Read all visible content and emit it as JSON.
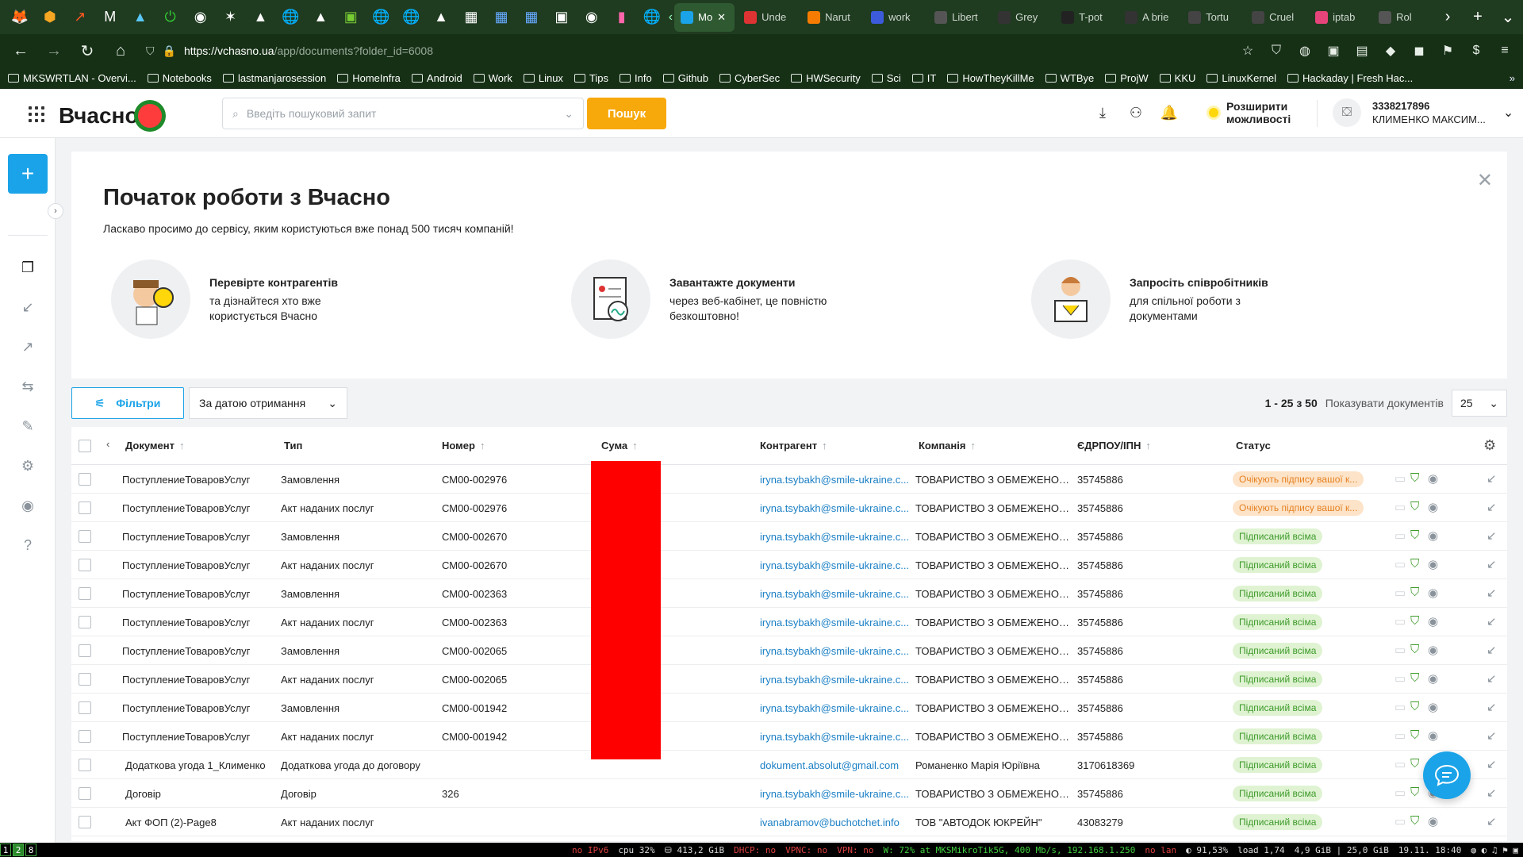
{
  "browser": {
    "tabs": [
      {
        "label": "Mo",
        "color": "#1aa3e8",
        "active": true
      },
      {
        "label": "Unde",
        "color": "#d33"
      },
      {
        "label": "Narut",
        "color": "#f57c00"
      },
      {
        "label": "work",
        "color": "#3b5bdb"
      },
      {
        "label": "Libert",
        "color": "#555"
      },
      {
        "label": "Grey",
        "color": "#333"
      },
      {
        "label": "T-pot",
        "color": "#222"
      },
      {
        "label": "A brie",
        "color": "#333"
      },
      {
        "label": "Tortu",
        "color": "#444"
      },
      {
        "label": "Cruel",
        "color": "#444"
      },
      {
        "label": "iptab",
        "color": "#e5447a"
      },
      {
        "label": "Rol",
        "color": "#555"
      }
    ],
    "url_host": "https://vchasno.ua",
    "url_path": "/app/documents?folder_id=6008",
    "bookmarks": [
      "MKSWRTLAN - Overvi...",
      "Notebooks",
      "lastmanjarosession",
      "HomeInfra",
      "Android",
      "Work",
      "Linux",
      "Tips",
      "Info",
      "Github",
      "CyberSec",
      "HWSecurity",
      "Sci",
      "IT",
      "HowTheyKillMe",
      "WTBye",
      "ProjW",
      "KKU",
      "LinuxKernel",
      "Hackaday | Fresh Hac..."
    ]
  },
  "header": {
    "logo": "Вчасно",
    "search_placeholder": "Введіть пошуковий запит",
    "search_button": "Пошук",
    "expand_label": "Розширити можливості",
    "account_id": "3338217896",
    "account_name": "КЛИМЕНКО МАКСИМ..."
  },
  "welcome": {
    "title": "Початок роботи з Вчасно",
    "subtitle": "Ласкаво просимо до сервісу, яким користуються вже понад 500 тисяч компаній!",
    "steps": [
      {
        "title": "Перевірте контрагентів",
        "text": "та дізнайтеся хто вже користується Вчасно"
      },
      {
        "title": "Завантажте документи",
        "text": "через веб-кабінет, це повністю безкоштовно!"
      },
      {
        "title": "Запросіть співробітників",
        "text": "для спільної роботи з документами"
      }
    ]
  },
  "toolbar": {
    "filters_label": "Фільтри",
    "sort_label": "За датою отримання",
    "range": "1 - 25 з 50",
    "show_label": "Показувати документів",
    "page_size": "25"
  },
  "table": {
    "columns": [
      "Документ",
      "Тип",
      "Номер",
      "Сума",
      "Контрагент",
      "Компанія",
      "ЄДРПОУ/ІПН",
      "Статус"
    ],
    "rows": [
      {
        "doc": "ПоступлениеТоваровУслуг",
        "type": "Замовлення",
        "num": "СМ00-002976",
        "contr": "iryna.tsybakh@smile-ukraine.c...",
        "comp": "ТОВАРИСТВО З ОБМЕЖЕНОЮ...",
        "code": "35745886",
        "status": "Очікують підпису вашої к...",
        "st": "wait"
      },
      {
        "doc": "ПоступлениеТоваровУслуг",
        "type": "Акт наданих послуг",
        "num": "СМ00-002976",
        "contr": "iryna.tsybakh@smile-ukraine.c...",
        "comp": "ТОВАРИСТВО З ОБМЕЖЕНОЮ...",
        "code": "35745886",
        "status": "Очікують підпису вашої к...",
        "st": "wait"
      },
      {
        "doc": "ПоступлениеТоваровУслуг",
        "type": "Замовлення",
        "num": "СМ00-002670",
        "contr": "iryna.tsybakh@smile-ukraine.c...",
        "comp": "ТОВАРИСТВО З ОБМЕЖЕНОЮ...",
        "code": "35745886",
        "status": "Підписаний всіма",
        "st": "ok"
      },
      {
        "doc": "ПоступлениеТоваровУслуг",
        "type": "Акт наданих послуг",
        "num": "СМ00-002670",
        "contr": "iryna.tsybakh@smile-ukraine.c...",
        "comp": "ТОВАРИСТВО З ОБМЕЖЕНОЮ...",
        "code": "35745886",
        "status": "Підписаний всіма",
        "st": "ok"
      },
      {
        "doc": "ПоступлениеТоваровУслуг",
        "type": "Замовлення",
        "num": "СМ00-002363",
        "contr": "iryna.tsybakh@smile-ukraine.c...",
        "comp": "ТОВАРИСТВО З ОБМЕЖЕНОЮ...",
        "code": "35745886",
        "status": "Підписаний всіма",
        "st": "ok"
      },
      {
        "doc": "ПоступлениеТоваровУслуг",
        "type": "Акт наданих послуг",
        "num": "СМ00-002363",
        "contr": "iryna.tsybakh@smile-ukraine.c...",
        "comp": "ТОВАРИСТВО З ОБМЕЖЕНОЮ...",
        "code": "35745886",
        "status": "Підписаний всіма",
        "st": "ok"
      },
      {
        "doc": "ПоступлениеТоваровУслуг",
        "type": "Замовлення",
        "num": "СМ00-002065",
        "contr": "iryna.tsybakh@smile-ukraine.c...",
        "comp": "ТОВАРИСТВО З ОБМЕЖЕНОЮ...",
        "code": "35745886",
        "status": "Підписаний всіма",
        "st": "ok"
      },
      {
        "doc": "ПоступлениеТоваровУслуг",
        "type": "Акт наданих послуг",
        "num": "СМ00-002065",
        "contr": "iryna.tsybakh@smile-ukraine.c...",
        "comp": "ТОВАРИСТВО З ОБМЕЖЕНОЮ...",
        "code": "35745886",
        "status": "Підписаний всіма",
        "st": "ok"
      },
      {
        "doc": "ПоступлениеТоваровУслуг",
        "type": "Замовлення",
        "num": "СМ00-001942",
        "contr": "iryna.tsybakh@smile-ukraine.c...",
        "comp": "ТОВАРИСТВО З ОБМЕЖЕНОЮ...",
        "code": "35745886",
        "status": "Підписаний всіма",
        "st": "ok"
      },
      {
        "doc": "ПоступлениеТоваровУслуг",
        "type": "Акт наданих послуг",
        "num": "СМ00-001942",
        "contr": "iryna.tsybakh@smile-ukraine.c...",
        "comp": "ТОВАРИСТВО З ОБМЕЖЕНОЮ...",
        "code": "35745886",
        "status": "Підписаний всіма",
        "st": "ok"
      },
      {
        "doc": "Додаткова угода 1_Клименко",
        "type": "Додаткова угода до договору",
        "num": "",
        "contr": "dokument.absolut@gmail.com",
        "comp": "Романенко Марія Юріївна",
        "code": "3170618369",
        "status": "Підписаний всіма",
        "st": "ok"
      },
      {
        "doc": "Договір",
        "type": "Договір",
        "num": "326",
        "contr": "iryna.tsybakh@smile-ukraine.c...",
        "comp": "ТОВАРИСТВО З ОБМЕЖЕНОЮ...",
        "code": "35745886",
        "status": "Підписаний всіма",
        "st": "ok"
      },
      {
        "doc": "Акт ФОП (2)-Page8",
        "type": "Акт наданих послуг",
        "num": "",
        "contr": "ivanabramov@buchotchet.info",
        "comp": "ТОВ \"АВТОДОК ЮКРЕЙН\"",
        "code": "43083279",
        "status": "Підписаний всіма",
        "st": "ok"
      }
    ]
  },
  "statusbar": {
    "workspaces": [
      "1",
      "2",
      "8"
    ],
    "ipv6": "no IPv6",
    "cpu": "cpu 32%",
    "disk": "⛁ 413,2 GiB",
    "dhcp": "DHCP: no",
    "vpnc": "VPNC: no",
    "vpn": "VPN: no",
    "wifi": "W: 72% at MKSMikroTik5G, 400 Mb/s, 192.168.1.250",
    "lan": "no lan",
    "battery": "◐ 91,53%",
    "load": "load 1,74",
    "mem": "4,9 GiB | 25,0 GiB",
    "clock": "19.11. 18:40"
  },
  "colors": {
    "accent": "#1aa3e8",
    "search_button": "#f7a80a",
    "tabbar": "#1f3b20",
    "status_wait": "#e58222",
    "status_ok": "#3d9a2a"
  }
}
